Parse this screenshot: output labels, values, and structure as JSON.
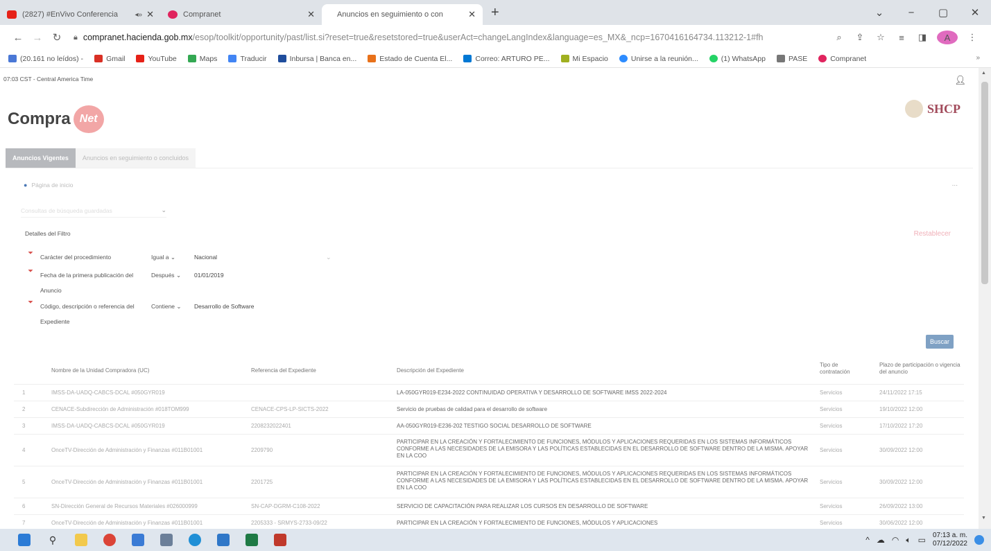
{
  "browser": {
    "tabs": [
      {
        "title": "(2827) #EnVivo Conferencia",
        "favicon_color": "#e62117",
        "audio": "◂»",
        "active": false
      },
      {
        "title": "Compranet",
        "favicon_color": "#e0245e",
        "active": false
      },
      {
        "title": "Anuncios en seguimiento o con",
        "favicon_color": "#ffffff",
        "active": true
      }
    ],
    "new_tab": "+",
    "window_controls": [
      "⌄",
      "−",
      "▢",
      "✕"
    ],
    "address": {
      "host": "compranet.hacienda.gob.mx",
      "path": "/esop/toolkit/opportunity/past/list.si?reset=true&resetstored=true&userAct=changeLangIndex&language=es_MX&_ncp=1670416164734.113212-1#fh"
    },
    "bookmarks": [
      {
        "label": "(20.161 no leídos) -",
        "color": "#4a78d6"
      },
      {
        "label": "Gmail",
        "color": "#d93025"
      },
      {
        "label": "YouTube",
        "color": "#e62117"
      },
      {
        "label": "Maps",
        "color": "#34a853"
      },
      {
        "label": "Traducir",
        "color": "#4285f4"
      },
      {
        "label": "Inbursa | Banca en...",
        "color": "#1f4d9c"
      },
      {
        "label": "Estado de Cuenta El...",
        "color": "#e8711a"
      },
      {
        "label": "Correo: ARTURO PE...",
        "color": "#0078d4"
      },
      {
        "label": "Mi Espacio",
        "color": "#a0b020"
      },
      {
        "label": "Unirse a la reunión...",
        "color": "#2d8cff"
      },
      {
        "label": "(1) WhatsApp",
        "color": "#25d366"
      },
      {
        "label": "PASE",
        "color": "#777777"
      },
      {
        "label": "Compranet",
        "color": "#e0245e"
      }
    ],
    "bookmarks_more": "»"
  },
  "page": {
    "timezone": "07:03 CST - Central America Time",
    "logo_text": "Compra",
    "logo_badge": "Net",
    "brand": "SHCP",
    "tabs": [
      {
        "label": "Anuncios Vigentes",
        "active": true
      },
      {
        "label": "Anuncios en seguimiento o concluidos",
        "active": false
      }
    ],
    "home_link": "Página de inicio",
    "more": "...",
    "saved_search_placeholder": "Consultas de búsqueda guardadas",
    "filter_title": "Detalles del Filtro",
    "clear_label": "Restablecer",
    "filters": [
      {
        "label": "Carácter del procedimiento",
        "operator": "Igual a",
        "value": "Nacional"
      },
      {
        "label": "Fecha de la primera publicación del Anuncio",
        "operator": "Después",
        "value": "01/01/2019"
      },
      {
        "label": "Código, descripción o referencia del Expediente",
        "operator": "Contiene",
        "value": "Desarrollo de Software"
      }
    ],
    "search_button": "Buscar",
    "table": {
      "headers": [
        "",
        "Nombre de la Unidad Compradora (UC)",
        "Referencia del Expediente",
        "Descripción del Expediente",
        "Tipo de contratación",
        "Plazo de participación o vigencia del anuncio"
      ],
      "rows": [
        {
          "n": "1",
          "uc": "IMSS-DA-UADQ-CABCS-DCAL #050GYR019",
          "ref": "",
          "desc": "LA-050GYR019-E234-2022 CONTINUIDAD OPERATIVA Y DESARROLLO DE SOFTWARE IMSS 2022-2024",
          "tipo": "Servicios",
          "plazo": "24/11/2022 17:15"
        },
        {
          "n": "2",
          "uc": "CENACE-Subdirección de Administración #018TOM999",
          "ref": "CENACE-CPS-LP-SICTS-2022",
          "desc": "Servicio de pruebas de calidad para el desarrollo de software",
          "tipo": "Servicios",
          "plazo": "19/10/2022 12:00"
        },
        {
          "n": "3",
          "uc": "IMSS-DA-UADQ-CABCS-DCAL #050GYR019",
          "ref": "2208232022401",
          "desc": "AA-050GYR019-E236-202 TESTIGO SOCIAL DESARROLLO DE SOFTWARE",
          "tipo": "Servicios",
          "plazo": "17/10/2022 17:20"
        },
        {
          "n": "4",
          "uc": "OnceTV-Dirección de Administración y Finanzas #011B01001",
          "ref": "2209790",
          "desc": "PARTICIPAR EN LA CREACIÓN Y FORTALECIMIENTO DE FUNCIONES, MÓDULOS Y APLICACIONES REQUERIDAS EN LOS SISTEMAS INFORMÁTICOS CONFORME A LAS NECESIDADES DE LA EMISORA Y LAS POLÍTICAS ESTABLECIDAS EN EL DESARROLLO DE SOFTWARE DENTRO DE LA MISMA. APOYAR EN LA COO",
          "tipo": "Servicios",
          "plazo": "30/09/2022 12:00"
        },
        {
          "n": "5",
          "uc": "OnceTV-Dirección de Administración y Finanzas #011B01001",
          "ref": "2201725",
          "desc": "PARTICIPAR EN LA CREACIÓN Y FORTALECIMIENTO DE FUNCIONES, MÓDULOS Y APLICACIONES REQUERIDAS EN LOS SISTEMAS INFORMÁTICOS CONFORME A LAS NECESIDADES DE LA EMISORA Y LAS POLÍTICAS ESTABLECIDAS EN EL DESARROLLO DE SOFTWARE DENTRO DE LA MISMA. APOYAR EN LA COO",
          "tipo": "Servicios",
          "plazo": "30/09/2022 12:00"
        },
        {
          "n": "6",
          "uc": "SN-Dirección General de Recursos Materiales #026000999",
          "ref": "SN-CAP-DGRM-C108-2022",
          "desc": "SERVICIO DE CAPACITACIÓN PARA REALIZAR LOS CURSOS EN DESARROLLO DE SOFTWARE",
          "tipo": "Servicios",
          "plazo": "26/09/2022 13:00"
        },
        {
          "n": "7",
          "uc": "OnceTV-Dirección de Administración y Finanzas #011B01001",
          "ref": "2205333 - SRMYS-2733-09/22",
          "desc": "PARTICIPAR EN LA CREACIÓN Y FORTALECIMIENTO DE FUNCIONES, MÓDULOS Y APLICACIONES",
          "tipo": "Servicios",
          "plazo": "30/06/2022 12:00"
        }
      ]
    }
  },
  "taskbar": {
    "apps": [
      {
        "name": "windows-start",
        "color": "#2b7bd6"
      },
      {
        "name": "search",
        "color": "#333333"
      },
      {
        "name": "file-explorer",
        "color": "#f2c94c"
      },
      {
        "name": "chrome",
        "color": "#db4437"
      },
      {
        "name": "mail",
        "color": "#3a7bd5"
      },
      {
        "name": "calculator",
        "color": "#6b7f99"
      },
      {
        "name": "edge",
        "color": "#1f8fd6"
      },
      {
        "name": "photos",
        "color": "#2f77c8"
      },
      {
        "name": "excel",
        "color": "#1f7a45"
      },
      {
        "name": "acrobat",
        "color": "#c0392b"
      }
    ],
    "time": "07:13 a. m.",
    "date": "07/12/2022"
  }
}
